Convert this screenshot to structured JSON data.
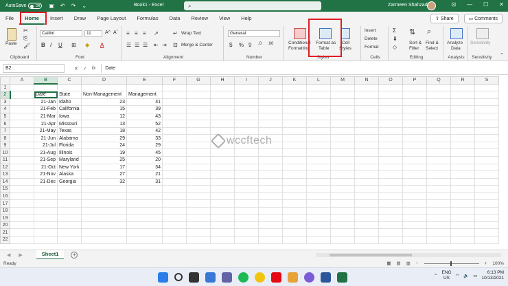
{
  "titlebar": {
    "autosave_label": "AutoSave",
    "autosave_state": "Off",
    "doc_title": "Book1 - Excel",
    "search_placeholder": "Search",
    "user_name": "Zarmeen Shahzad"
  },
  "tabs": [
    "File",
    "Home",
    "Insert",
    "Draw",
    "Page Layout",
    "Formulas",
    "Data",
    "Review",
    "View",
    "Help"
  ],
  "active_tab": "Home",
  "share_label": "Share",
  "comments_label": "Comments",
  "ribbon": {
    "clipboard": {
      "label": "Clipboard",
      "paste": "Paste"
    },
    "font": {
      "label": "Font",
      "font_name": "Calibri",
      "font_size": "11"
    },
    "alignment": {
      "label": "Alignment",
      "wrap_text": "Wrap Text",
      "merge_center": "Merge & Center"
    },
    "number": {
      "label": "Number",
      "format": "General"
    },
    "styles": {
      "label": "Styles",
      "conditional_1": "Conditional",
      "conditional_2": "Formatting",
      "format_as_1": "Format as",
      "format_as_2": "Table",
      "cell_1": "Cell",
      "cell_2": "Styles"
    },
    "cells": {
      "label": "Cells",
      "insert": "Insert",
      "delete": "Delete",
      "format": "Format"
    },
    "editing": {
      "label": "Editing",
      "sort_1": "Sort &",
      "sort_2": "Filter",
      "find_1": "Find &",
      "find_2": "Select"
    },
    "analysis": {
      "label": "Analysis",
      "analyze_1": "Analyze",
      "analyze_2": "Data"
    },
    "sensitivity": {
      "label": "Sensitivity",
      "btn": "Sensitivity"
    }
  },
  "formula_bar": {
    "name_box": "B2",
    "formula": "Date"
  },
  "grid": {
    "columns": [
      "A",
      "B",
      "C",
      "D",
      "E",
      "F",
      "G",
      "H",
      "I",
      "J",
      "K",
      "L",
      "M",
      "N",
      "O",
      "P",
      "Q",
      "R",
      "S"
    ],
    "headers": [
      "Date",
      "State",
      "Non-Management",
      "Management"
    ],
    "rows": [
      [
        "21-Jan",
        "Idaho",
        "23",
        "41"
      ],
      [
        "21-Feb",
        "California",
        "15",
        "39"
      ],
      [
        "21-Mar",
        "Iowa",
        "12",
        "43"
      ],
      [
        "21-Apr",
        "Missouri",
        "13",
        "52"
      ],
      [
        "21-May",
        "Texas",
        "18",
        "42"
      ],
      [
        "21-Jun",
        "Alabama",
        "29",
        "33"
      ],
      [
        "21-Jul",
        "Florida",
        "24",
        "29"
      ],
      [
        "21-Aug",
        "Illinois",
        "19",
        "45"
      ],
      [
        "21-Sep",
        "Maryland",
        "25",
        "20"
      ],
      [
        "21-Oct",
        "New York",
        "17",
        "34"
      ],
      [
        "21-Nov",
        "Alaska",
        "27",
        "21"
      ],
      [
        "21-Dec",
        "Georgia",
        "32",
        "31"
      ]
    ],
    "row_count": 22
  },
  "watermark": "wccftech",
  "sheet_tab": "Sheet1",
  "status": {
    "ready": "Ready",
    "zoom": "100%"
  },
  "taskbar": {
    "lang_1": "ENG",
    "lang_2": "US",
    "time": "6:13 PM",
    "date": "10/13/2021"
  }
}
